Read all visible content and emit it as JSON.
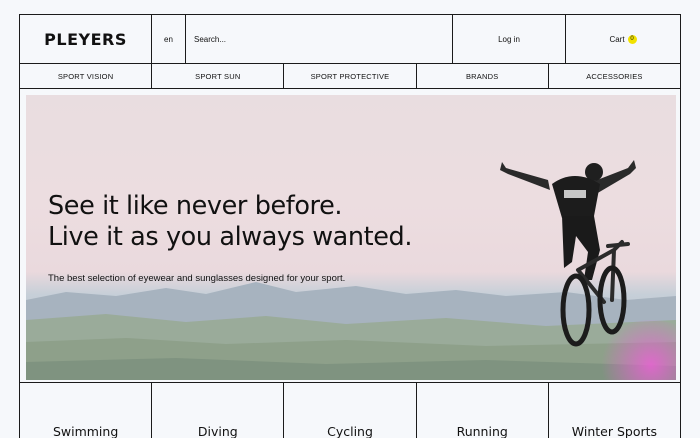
{
  "header": {
    "logo": "PLEYERS",
    "language": "en",
    "search_placeholder": "Search...",
    "login_label": "Log in",
    "cart_label": "Cart",
    "cart_count": "0"
  },
  "nav": {
    "items": [
      {
        "label": "SPORT VISION"
      },
      {
        "label": "SPORT SUN"
      },
      {
        "label": "SPORT PROTECTIVE"
      },
      {
        "label": "BRANDS"
      },
      {
        "label": "ACCESSORIES"
      }
    ]
  },
  "hero": {
    "headline_line1": "See it like never before.",
    "headline_line2": "Live it as you always wanted.",
    "subtitle": "The best selection of eyewear and sunglasses designed for your sport."
  },
  "categories": {
    "items": [
      {
        "label": "Swimming"
      },
      {
        "label": "Diving"
      },
      {
        "label": "Cycling"
      },
      {
        "label": "Running"
      },
      {
        "label": "Winter Sports"
      }
    ]
  },
  "colors": {
    "border": "#1b1b1b",
    "background": "#f6f8fb",
    "cart_badge": "#f2e200",
    "accent_glow": "#ec60d6"
  }
}
